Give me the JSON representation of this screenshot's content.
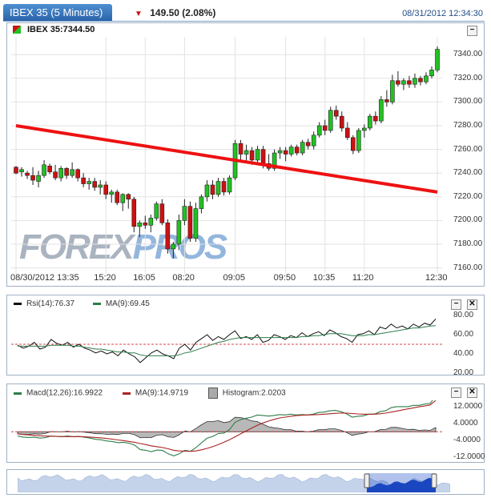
{
  "header": {
    "title": "IBEX 35 (5 Minutes)",
    "change": "149.50",
    "change_pct": "(2.08%)",
    "timestamp": "08/31/2012 12:34:30",
    "down_color": "#cc1111"
  },
  "main_chart": {
    "label": "IBEX 35:7344.50",
    "watermark_a": "FOREX",
    "watermark_b": "PROS",
    "y_ticks": [
      "7340.00",
      "7320.00",
      "7300.00",
      "7280.00",
      "7260.00",
      "7240.00",
      "7220.00",
      "7200.00",
      "7180.00",
      "7160.00"
    ],
    "x_ticks": [
      "08/30/2012 13:35",
      "15:20",
      "16:05",
      "08:20",
      "09:05",
      "09:50",
      "10:35",
      "11:20",
      "12:30"
    ],
    "colors": {
      "up": "#22c122",
      "down": "#cc1111",
      "trendline": "#ee1111"
    }
  },
  "rsi_panel": {
    "rsi_label": "Rsi(14):76.37",
    "ma_label": "MA(9):69.45",
    "y_ticks": [
      "80.00",
      "60.00",
      "40.00",
      "20.00"
    ]
  },
  "macd_panel": {
    "macd_label": "Macd(12,26):16.9922",
    "ma_label": "MA(9):14.9719",
    "hist_label": "Histogram:2.0203",
    "y_ticks": [
      "12.0000",
      "4.0000",
      "-4.0000",
      "-12.0000"
    ]
  },
  "chart_data": [
    {
      "type": "candlestick",
      "title": "IBEX 35 (5 Minutes)",
      "ylim": [
        7155,
        7355
      ],
      "candles": [
        [
          7245,
          7246,
          7239,
          7240
        ],
        [
          7241,
          7245,
          7237,
          7243
        ],
        [
          7240,
          7242,
          7235,
          7238
        ],
        [
          7238,
          7245,
          7230,
          7234
        ],
        [
          7233,
          7242,
          7228,
          7238
        ],
        [
          7238,
          7251,
          7236,
          7247
        ],
        [
          7246,
          7248,
          7239,
          7241
        ],
        [
          7241,
          7247,
          7234,
          7236
        ],
        [
          7236,
          7246,
          7233,
          7244
        ],
        [
          7244,
          7245,
          7235,
          7238
        ],
        [
          7238,
          7249,
          7236,
          7243
        ],
        [
          7243,
          7244,
          7233,
          7236
        ],
        [
          7236,
          7240,
          7228,
          7231
        ],
        [
          7231,
          7236,
          7226,
          7233
        ],
        [
          7233,
          7236,
          7225,
          7228
        ],
        [
          7228,
          7234,
          7222,
          7230
        ],
        [
          7230,
          7233,
          7218,
          7222
        ],
        [
          7222,
          7226,
          7215,
          7224
        ],
        [
          7224,
          7226,
          7213,
          7215
        ],
        [
          7215,
          7223,
          7208,
          7222
        ],
        [
          7222,
          7223,
          7210,
          7218
        ],
        [
          7218,
          7220,
          7190,
          7195
        ],
        [
          7195,
          7200,
          7186,
          7198
        ],
        [
          7198,
          7204,
          7193,
          7196
        ],
        [
          7196,
          7205,
          7190,
          7202
        ],
        [
          7202,
          7216,
          7200,
          7214
        ],
        [
          7214,
          7218,
          7196,
          7198
        ],
        [
          7198,
          7201,
          7172,
          7176
        ],
        [
          7176,
          7182,
          7168,
          7180
        ],
        [
          7180,
          7205,
          7175,
          7200
        ],
        [
          7200,
          7218,
          7196,
          7212
        ],
        [
          7212,
          7216,
          7182,
          7185
        ],
        [
          7185,
          7215,
          7182,
          7210
        ],
        [
          7210,
          7222,
          7206,
          7220
        ],
        [
          7220,
          7234,
          7216,
          7230
        ],
        [
          7230,
          7234,
          7218,
          7222
        ],
        [
          7222,
          7236,
          7220,
          7233
        ],
        [
          7233,
          7236,
          7221,
          7224
        ],
        [
          7224,
          7238,
          7222,
          7236
        ],
        [
          7236,
          7268,
          7234,
          7265
        ],
        [
          7265,
          7268,
          7250,
          7256
        ],
        [
          7256,
          7264,
          7249,
          7259
        ],
        [
          7259,
          7262,
          7247,
          7251
        ],
        [
          7251,
          7263,
          7248,
          7260
        ],
        [
          7260,
          7263,
          7244,
          7248
        ],
        [
          7248,
          7256,
          7242,
          7244
        ],
        [
          7244,
          7260,
          7242,
          7257
        ],
        [
          7257,
          7262,
          7252,
          7259
        ],
        [
          7259,
          7262,
          7250,
          7256
        ],
        [
          7256,
          7264,
          7254,
          7262
        ],
        [
          7262,
          7264,
          7255,
          7257
        ],
        [
          7257,
          7268,
          7255,
          7266
        ],
        [
          7266,
          7269,
          7260,
          7263
        ],
        [
          7263,
          7275,
          7260,
          7272
        ],
        [
          7272,
          7283,
          7270,
          7280
        ],
        [
          7280,
          7285,
          7272,
          7276
        ],
        [
          7276,
          7296,
          7274,
          7293
        ],
        [
          7293,
          7297,
          7285,
          7288
        ],
        [
          7288,
          7292,
          7275,
          7278
        ],
        [
          7278,
          7283,
          7268,
          7270
        ],
        [
          7270,
          7272,
          7256,
          7259
        ],
        [
          7259,
          7278,
          7257,
          7276
        ],
        [
          7276,
          7281,
          7270,
          7278
        ],
        [
          7278,
          7290,
          7276,
          7288
        ],
        [
          7288,
          7292,
          7281,
          7284
        ],
        [
          7284,
          7305,
          7282,
          7302
        ],
        [
          7302,
          7310,
          7296,
          7300
        ],
        [
          7300,
          7323,
          7298,
          7318
        ],
        [
          7318,
          7326,
          7313,
          7315
        ],
        [
          7315,
          7320,
          7310,
          7318
        ],
        [
          7318,
          7322,
          7312,
          7315
        ],
        [
          7315,
          7324,
          7312,
          7320
        ],
        [
          7320,
          7322,
          7314,
          7317
        ],
        [
          7317,
          7325,
          7315,
          7322
        ],
        [
          7322,
          7330,
          7320,
          7327
        ],
        [
          7327,
          7347,
          7325,
          7344.5
        ]
      ],
      "trendline": [
        [
          0,
          7280
        ],
        [
          75,
          7224
        ]
      ]
    },
    {
      "type": "line",
      "title": "Rsi(14)",
      "ylim": [
        20,
        85
      ],
      "series": [
        {
          "name": "Rsi(14)",
          "values": [
            49,
            46,
            48,
            52,
            45,
            47,
            55,
            51,
            49,
            52,
            47,
            50,
            46,
            44,
            41,
            43,
            40,
            42,
            38,
            44,
            40,
            37,
            31,
            36,
            41,
            44,
            40,
            38,
            35,
            46,
            50,
            44,
            52,
            56,
            60,
            54,
            58,
            55,
            60,
            64,
            56,
            58,
            55,
            60,
            52,
            54,
            60,
            58,
            55,
            59,
            57,
            62,
            58,
            61,
            63,
            59,
            65,
            62,
            58,
            56,
            52,
            60,
            61,
            64,
            60,
            68,
            66,
            71,
            67,
            69,
            66,
            71,
            68,
            72,
            70,
            76.37
          ]
        },
        {
          "name": "MA(9)",
          "values": [
            48,
            48,
            48,
            48,
            48,
            48,
            49,
            49,
            49,
            49,
            48,
            48,
            47,
            46,
            45,
            45,
            44,
            43,
            42,
            42,
            41,
            41,
            39,
            38,
            38,
            38,
            38,
            38,
            38,
            39,
            41,
            42,
            44,
            46,
            48,
            50,
            52,
            53,
            55,
            56,
            57,
            57,
            57,
            57,
            57,
            57,
            57,
            57,
            57,
            57,
            57,
            58,
            58,
            59,
            59,
            60,
            61,
            61,
            61,
            60,
            59,
            59,
            59,
            60,
            60,
            61,
            62,
            63,
            64,
            65,
            66,
            67,
            67,
            68,
            69,
            69.45
          ]
        }
      ]
    },
    {
      "type": "line",
      "title": "Macd(12,26)",
      "ylim": [
        -14,
        15
      ],
      "series": [
        {
          "name": "Macd(12,26)",
          "values": [
            -2,
            -2.5,
            -2.7,
            -2.6,
            -3,
            -2.8,
            -2,
            -2.2,
            -2.3,
            -2,
            -2.4,
            -2.2,
            -2.6,
            -3,
            -3.6,
            -3.8,
            -4.4,
            -4.6,
            -5.2,
            -5,
            -5.4,
            -6.4,
            -8.5,
            -8.8,
            -9.5,
            -8.7,
            -8.9,
            -10.5,
            -11.5,
            -10.5,
            -8.8,
            -9.3,
            -7.5,
            -5.2,
            -3,
            -2.2,
            -0.8,
            -0.6,
            1,
            4.5,
            5.8,
            6.5,
            7,
            8,
            7.8,
            7.5,
            7.8,
            8.2,
            8,
            8.4,
            8,
            8.2,
            8,
            8.4,
            9.2,
            9.4,
            10,
            10.2,
            9.6,
            8.6,
            7,
            7.4,
            7.6,
            8.4,
            8.4,
            9.6,
            10,
            11.5,
            12,
            12,
            12,
            12.6,
            12.6,
            13.2,
            13.5,
            16.99
          ]
        },
        {
          "name": "MA(9)",
          "values": [
            -1,
            -1.3,
            -1.5,
            -1.7,
            -1.9,
            -2,
            -2.1,
            -2.2,
            -2.3,
            -2.3,
            -2.3,
            -2.3,
            -2.4,
            -2.5,
            -2.7,
            -2.9,
            -3.2,
            -3.5,
            -3.9,
            -4.2,
            -4.6,
            -5,
            -5.6,
            -6.1,
            -6.7,
            -7.1,
            -7.5,
            -8.1,
            -8.8,
            -9.1,
            -9.2,
            -9.3,
            -9.1,
            -8.6,
            -7.9,
            -7.1,
            -6.1,
            -5,
            -3.8,
            -2.4,
            -1,
            0.4,
            1.8,
            3.1,
            4.2,
            5.1,
            5.9,
            6.6,
            7,
            7.4,
            7.7,
            7.9,
            8,
            8.1,
            8.2,
            8.4,
            8.6,
            8.8,
            8.9,
            8.9,
            8.7,
            8.5,
            8.4,
            8.4,
            8.4,
            8.6,
            8.9,
            9.4,
            9.9,
            10.4,
            10.9,
            11.4,
            11.9,
            12.3,
            12.8,
            14.97
          ]
        },
        {
          "name": "Histogram",
          "values": [
            -1,
            -1.2,
            -1.2,
            -0.9,
            -1.1,
            -0.8,
            0.1,
            0,
            0,
            0.3,
            -0.1,
            0.1,
            -0.2,
            -0.5,
            -0.9,
            -0.9,
            -1.2,
            -1.1,
            -1.3,
            -0.8,
            -0.8,
            -1.4,
            -2.9,
            -2.7,
            -2.8,
            -1.6,
            -1.4,
            -2.4,
            -2.7,
            -1.4,
            0.4,
            0,
            1.6,
            3.4,
            4.9,
            4.9,
            5.3,
            4.4,
            4.8,
            6.9,
            6.8,
            6.1,
            5.2,
            4.9,
            3.6,
            2.4,
            1.9,
            1.6,
            1,
            1,
            0.3,
            0.3,
            0,
            0.3,
            1,
            1,
            1.4,
            1.4,
            0.7,
            -0.3,
            -1.7,
            -1.1,
            -0.8,
            0,
            0,
            1,
            1.1,
            2.1,
            2.1,
            1.6,
            1.1,
            1.2,
            0.7,
            0.9,
            0.7,
            2.02
          ]
        }
      ]
    }
  ]
}
